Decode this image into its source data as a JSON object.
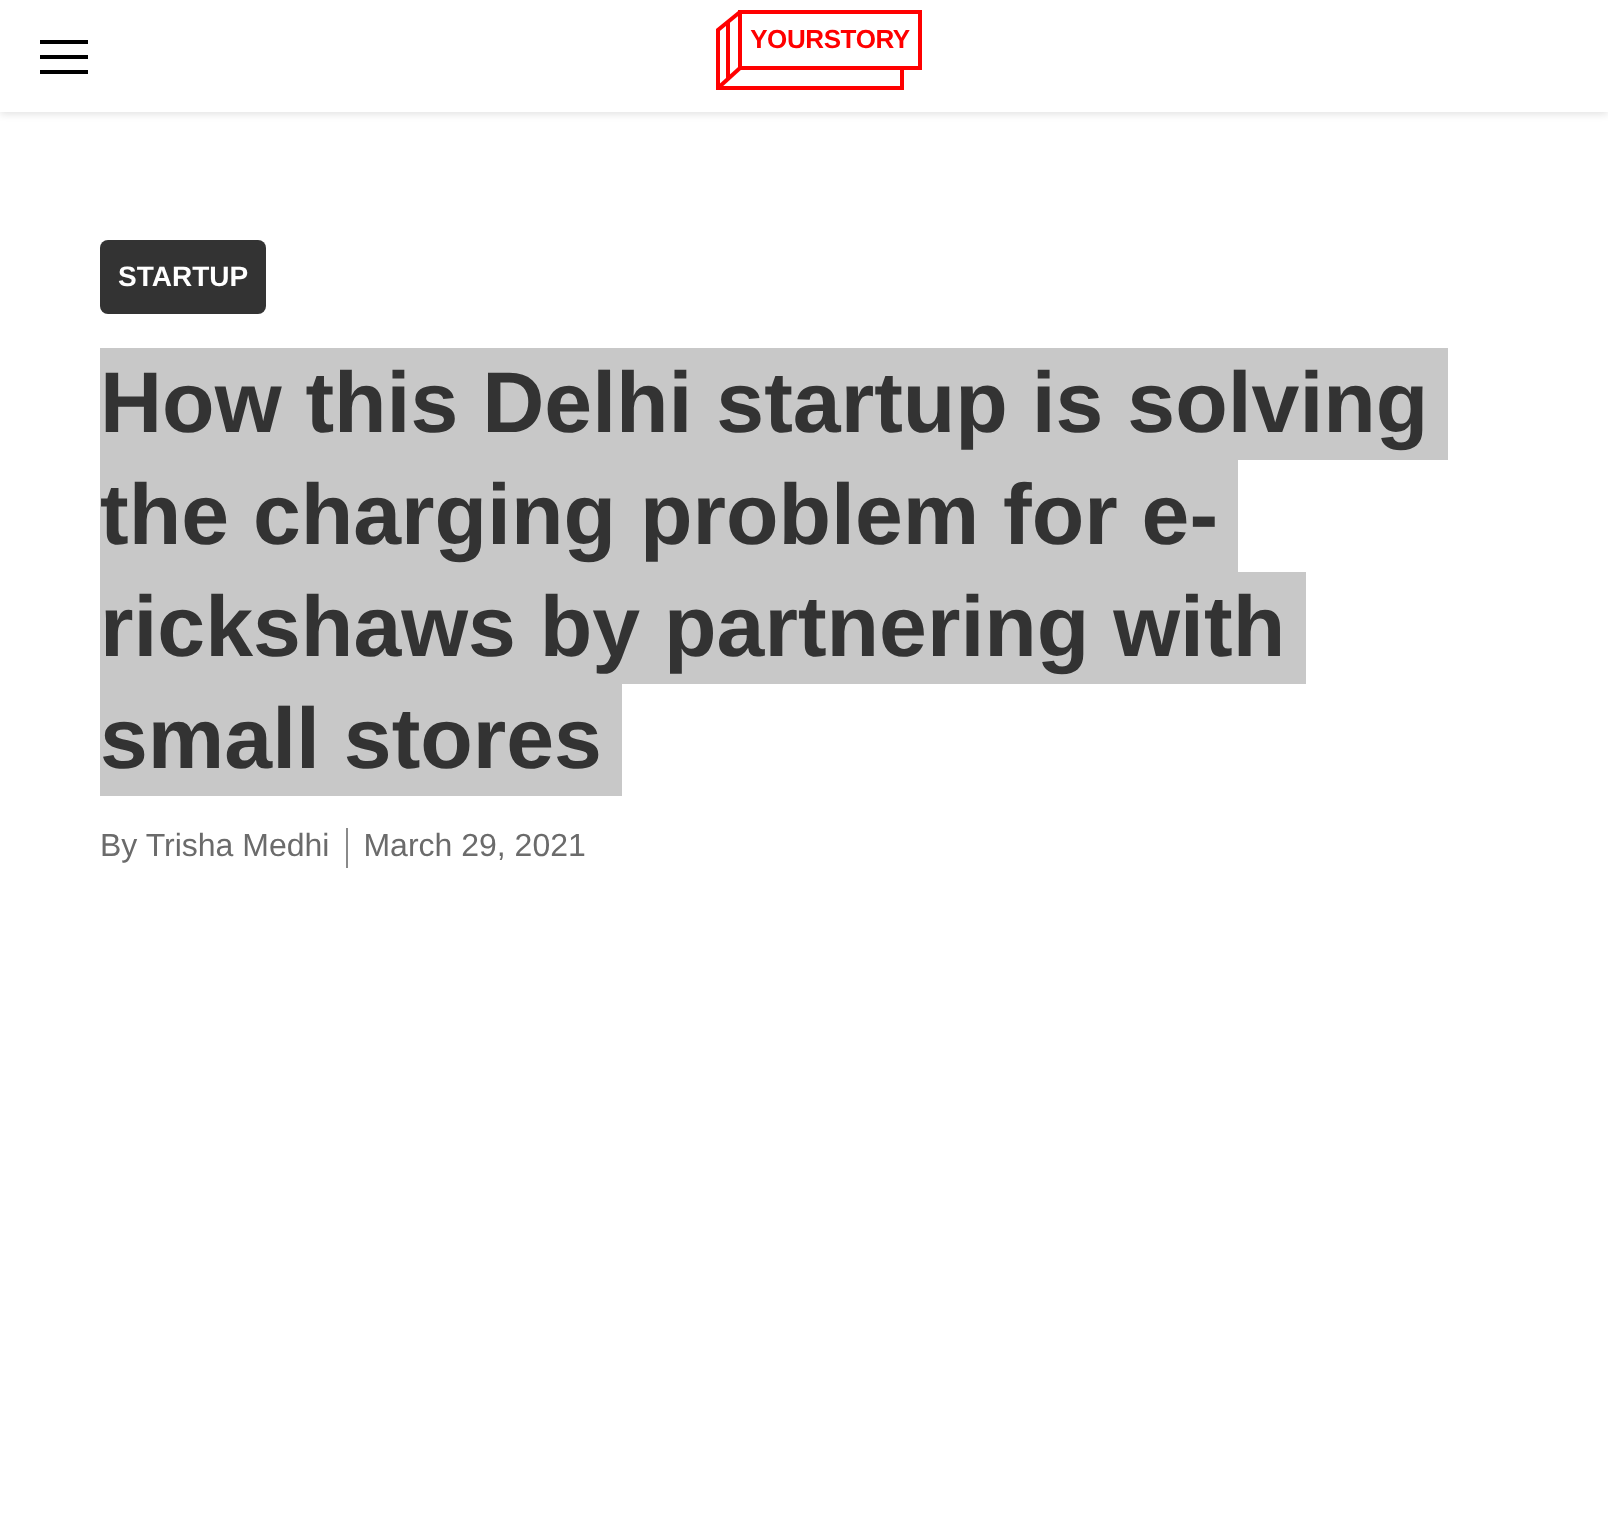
{
  "header": {
    "logo": "YOURSTORY"
  },
  "article": {
    "category": "STARTUP",
    "headline": {
      "text": "How this Delhi startup is solving the charging problem for e-rickshaws by partnering with small stores",
      "highlighted": true
    },
    "byline": {
      "author": "By Trisha Medhi",
      "date": "March 29, 2021"
    }
  }
}
